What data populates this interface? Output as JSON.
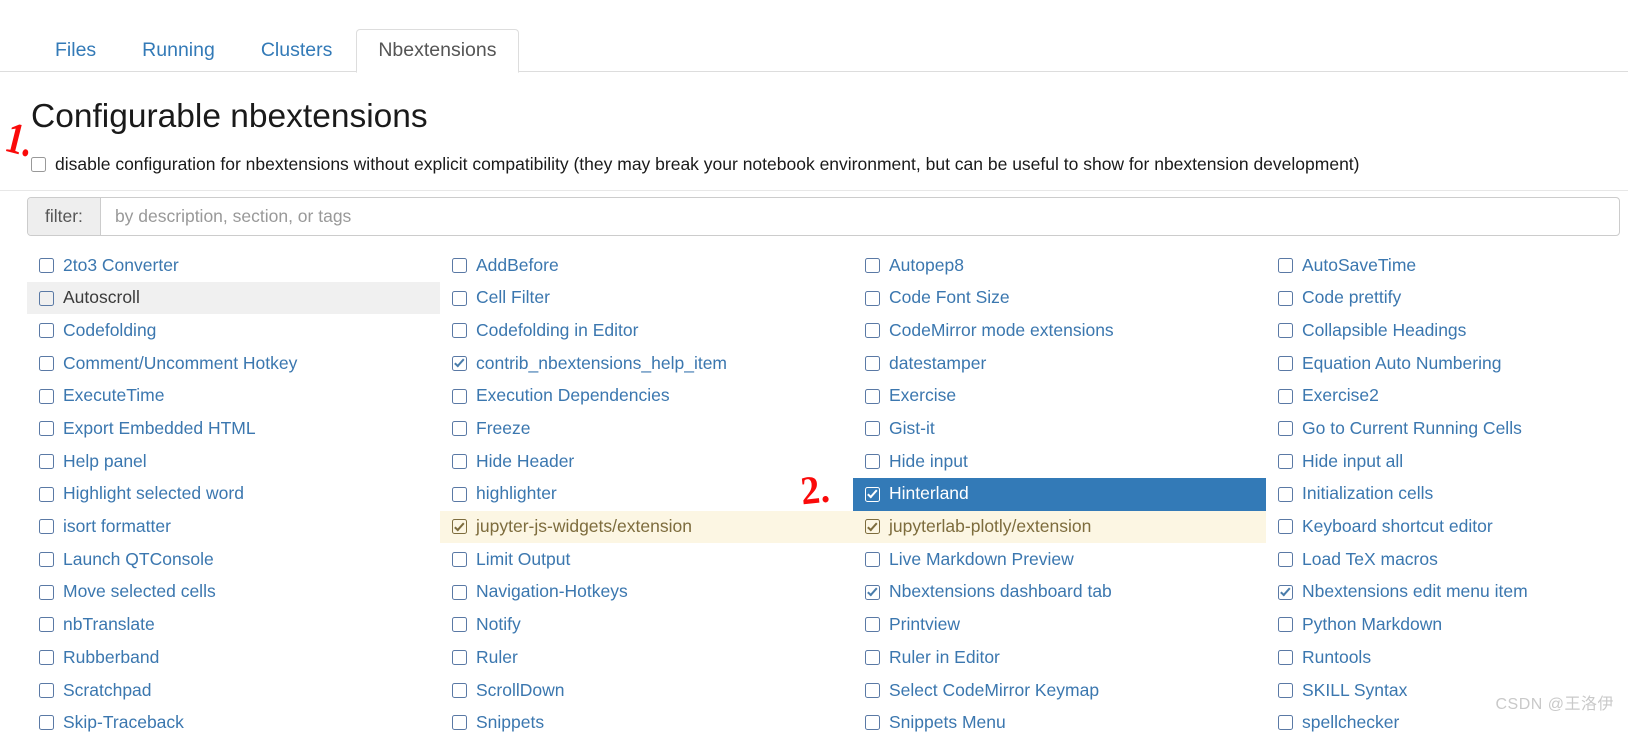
{
  "tabs": [
    {
      "label": "Files",
      "active": false
    },
    {
      "label": "Running",
      "active": false
    },
    {
      "label": "Clusters",
      "active": false
    },
    {
      "label": "Nbextensions",
      "active": true
    }
  ],
  "page_title": "Configurable nbextensions",
  "disable_config": {
    "checked": false,
    "label": "disable configuration for nbextensions without explicit compatibility (they may break your notebook environment, but can be useful to show for nbextension development)"
  },
  "filter": {
    "addon_label": "filter:",
    "placeholder": "by description, section, or tags",
    "value": ""
  },
  "colors": {
    "link": "#3b77af",
    "tab_link": "#337ab7",
    "selected_bg": "#337ab7",
    "selected_fg": "#ffffff",
    "widget_bg": "#fcf6e3",
    "widget_fg": "#7d6c3d",
    "hover_bg": "#f0f0f0",
    "annotation_red": "#fa0a0a"
  },
  "annotations": [
    {
      "text": "1.",
      "name": "annotation-1"
    },
    {
      "text": "2.",
      "name": "annotation-2"
    }
  ],
  "watermark": "CSDN @王洛伊",
  "extensions": {
    "columns": [
      [
        {
          "label": "2to3 Converter",
          "checked": false,
          "state": "normal"
        },
        {
          "label": "Autoscroll",
          "checked": false,
          "state": "hover"
        },
        {
          "label": "Codefolding",
          "checked": false,
          "state": "normal"
        },
        {
          "label": "Comment/Uncomment Hotkey",
          "checked": false,
          "state": "normal"
        },
        {
          "label": "ExecuteTime",
          "checked": false,
          "state": "normal"
        },
        {
          "label": "Export Embedded HTML",
          "checked": false,
          "state": "normal"
        },
        {
          "label": "Help panel",
          "checked": false,
          "state": "normal"
        },
        {
          "label": "Highlight selected word",
          "checked": false,
          "state": "normal"
        },
        {
          "label": "isort formatter",
          "checked": false,
          "state": "normal"
        },
        {
          "label": "Launch QTConsole",
          "checked": false,
          "state": "normal"
        },
        {
          "label": "Move selected cells",
          "checked": false,
          "state": "normal"
        },
        {
          "label": "nbTranslate",
          "checked": false,
          "state": "normal"
        },
        {
          "label": "Rubberband",
          "checked": false,
          "state": "normal"
        },
        {
          "label": "Scratchpad",
          "checked": false,
          "state": "normal"
        },
        {
          "label": "Skip-Traceback",
          "checked": false,
          "state": "normal"
        }
      ],
      [
        {
          "label": "AddBefore",
          "checked": false,
          "state": "normal"
        },
        {
          "label": "Cell Filter",
          "checked": false,
          "state": "normal"
        },
        {
          "label": "Codefolding in Editor",
          "checked": false,
          "state": "normal"
        },
        {
          "label": "contrib_nbextensions_help_item",
          "checked": true,
          "state": "normal"
        },
        {
          "label": "Execution Dependencies",
          "checked": false,
          "state": "normal"
        },
        {
          "label": "Freeze",
          "checked": false,
          "state": "normal"
        },
        {
          "label": "Hide Header",
          "checked": false,
          "state": "normal"
        },
        {
          "label": "highlighter",
          "checked": false,
          "state": "normal"
        },
        {
          "label": "jupyter-js-widgets/extension",
          "checked": true,
          "state": "widget"
        },
        {
          "label": "Limit Output",
          "checked": false,
          "state": "normal"
        },
        {
          "label": "Navigation-Hotkeys",
          "checked": false,
          "state": "normal"
        },
        {
          "label": "Notify",
          "checked": false,
          "state": "normal"
        },
        {
          "label": "Ruler",
          "checked": false,
          "state": "normal"
        },
        {
          "label": "ScrollDown",
          "checked": false,
          "state": "normal"
        },
        {
          "label": "Snippets",
          "checked": false,
          "state": "normal"
        }
      ],
      [
        {
          "label": "Autopep8",
          "checked": false,
          "state": "normal"
        },
        {
          "label": "Code Font Size",
          "checked": false,
          "state": "normal"
        },
        {
          "label": "CodeMirror mode extensions",
          "checked": false,
          "state": "normal"
        },
        {
          "label": "datestamper",
          "checked": false,
          "state": "normal"
        },
        {
          "label": "Exercise",
          "checked": false,
          "state": "normal"
        },
        {
          "label": "Gist-it",
          "checked": false,
          "state": "normal"
        },
        {
          "label": "Hide input",
          "checked": false,
          "state": "normal"
        },
        {
          "label": "Hinterland",
          "checked": true,
          "state": "selected"
        },
        {
          "label": "jupyterlab-plotly/extension",
          "checked": true,
          "state": "widget"
        },
        {
          "label": "Live Markdown Preview",
          "checked": false,
          "state": "normal"
        },
        {
          "label": "Nbextensions dashboard tab",
          "checked": true,
          "state": "normal"
        },
        {
          "label": "Printview",
          "checked": false,
          "state": "normal"
        },
        {
          "label": "Ruler in Editor",
          "checked": false,
          "state": "normal"
        },
        {
          "label": "Select CodeMirror Keymap",
          "checked": false,
          "state": "normal"
        },
        {
          "label": "Snippets Menu",
          "checked": false,
          "state": "normal"
        }
      ],
      [
        {
          "label": "AutoSaveTime",
          "checked": false,
          "state": "normal"
        },
        {
          "label": "Code prettify",
          "checked": false,
          "state": "normal"
        },
        {
          "label": "Collapsible Headings",
          "checked": false,
          "state": "normal"
        },
        {
          "label": "Equation Auto Numbering",
          "checked": false,
          "state": "normal"
        },
        {
          "label": "Exercise2",
          "checked": false,
          "state": "normal"
        },
        {
          "label": "Go to Current Running Cells",
          "checked": false,
          "state": "normal"
        },
        {
          "label": "Hide input all",
          "checked": false,
          "state": "normal"
        },
        {
          "label": "Initialization cells",
          "checked": false,
          "state": "normal"
        },
        {
          "label": "Keyboard shortcut editor",
          "checked": false,
          "state": "normal"
        },
        {
          "label": "Load TeX macros",
          "checked": false,
          "state": "normal"
        },
        {
          "label": "Nbextensions edit menu item",
          "checked": true,
          "state": "normal"
        },
        {
          "label": "Python Markdown",
          "checked": false,
          "state": "normal"
        },
        {
          "label": "Runtools",
          "checked": false,
          "state": "normal"
        },
        {
          "label": "SKILL Syntax",
          "checked": false,
          "state": "normal"
        },
        {
          "label": "spellchecker",
          "checked": false,
          "state": "normal"
        }
      ]
    ]
  }
}
